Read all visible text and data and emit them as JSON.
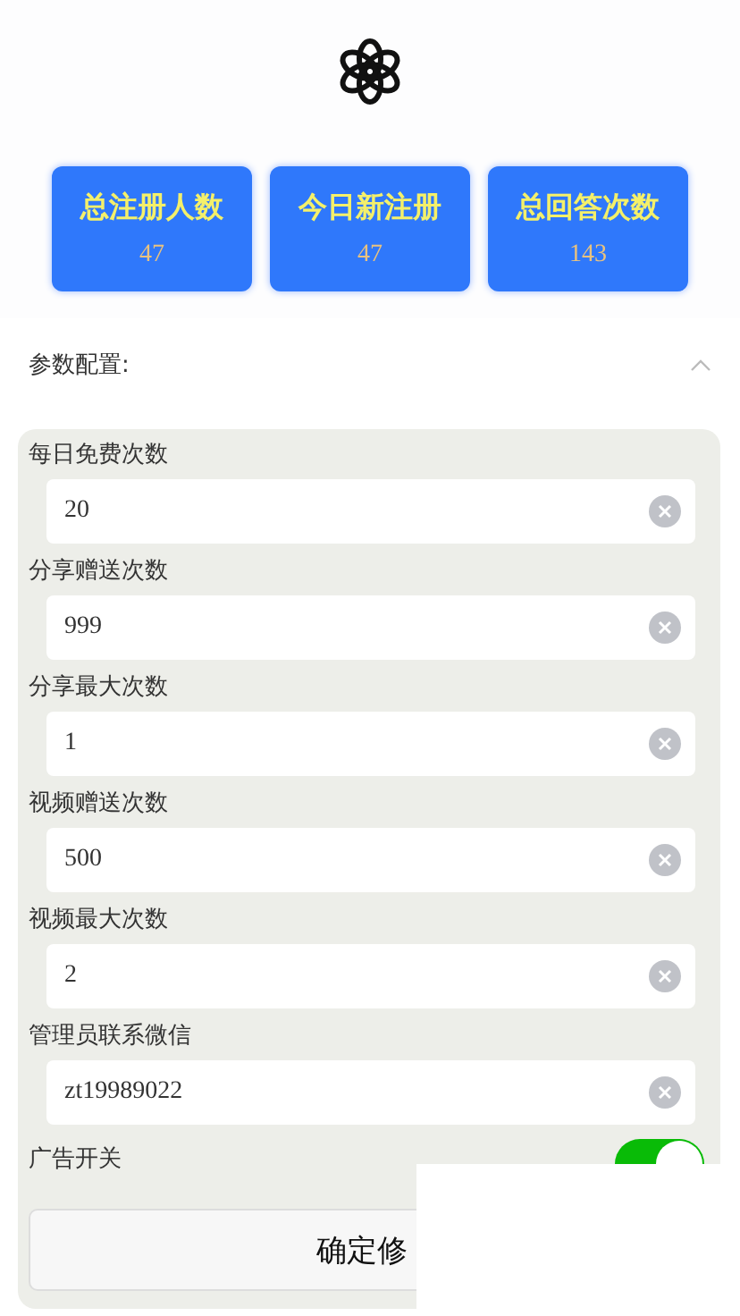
{
  "stats": [
    {
      "label": "总注册人数",
      "value": "47"
    },
    {
      "label": "今日新注册",
      "value": "47"
    },
    {
      "label": "总回答次数",
      "value": "143"
    }
  ],
  "section": {
    "title": "参数配置:",
    "expanded": true
  },
  "fields": [
    {
      "kind": "input",
      "label": "每日免费次数",
      "value": "20"
    },
    {
      "kind": "input",
      "label": "分享赠送次数",
      "value": "999"
    },
    {
      "kind": "input",
      "label": "分享最大次数",
      "value": "1"
    },
    {
      "kind": "input",
      "label": "视频赠送次数",
      "value": "500"
    },
    {
      "kind": "input",
      "label": "视频最大次数",
      "value": "2"
    },
    {
      "kind": "input",
      "label": "管理员联系微信",
      "value": "zt19989022"
    },
    {
      "kind": "switch",
      "label": "广告开关",
      "on": true
    }
  ],
  "submit": {
    "label": "确定修"
  }
}
